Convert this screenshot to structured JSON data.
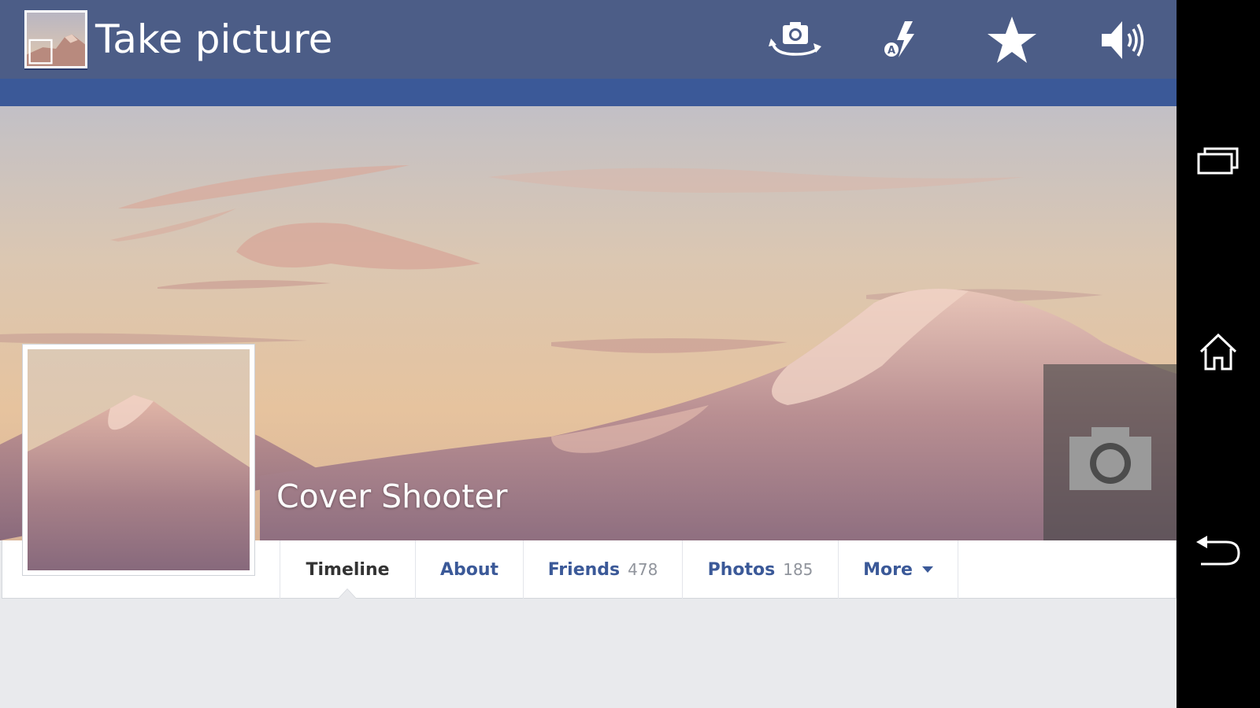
{
  "action_bar": {
    "title": "Take picture",
    "bg_color": "#4c5d87",
    "icons": [
      "switch-camera-icon",
      "auto-flash-icon",
      "star-icon",
      "volume-icon"
    ]
  },
  "strip_color": "#3b5998",
  "cover": {
    "profile_name": "Cover Shooter",
    "shutter_icon": "camera-icon"
  },
  "tabs": [
    {
      "label": "Timeline",
      "count": "",
      "active": true
    },
    {
      "label": "About",
      "count": ""
    },
    {
      "label": "Friends",
      "count": "478"
    },
    {
      "label": "Photos",
      "count": "185"
    },
    {
      "label": "More",
      "count": ""
    }
  ],
  "nav_bar": {
    "icons": [
      "recent-apps-icon",
      "home-icon",
      "back-icon"
    ]
  }
}
